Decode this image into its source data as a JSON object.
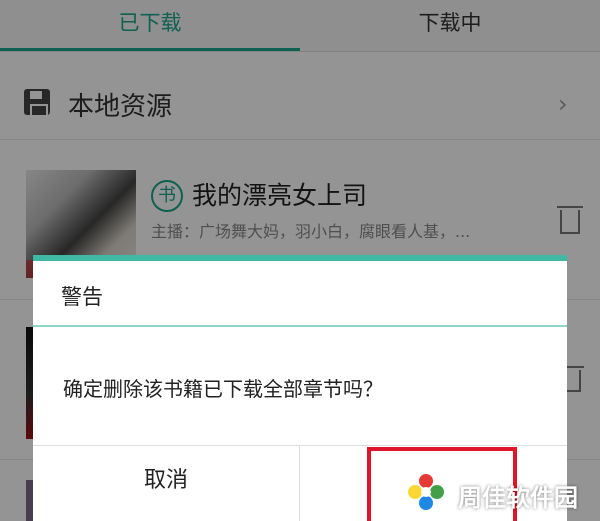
{
  "tabs": [
    {
      "label": "已下载",
      "active": true
    },
    {
      "label": "下载中",
      "active": false
    }
  ],
  "local_resources": {
    "label": "本地资源",
    "icon": "floppy-icon",
    "chevron": "›"
  },
  "books": [
    {
      "badge": "书",
      "title": "我的漂亮女上司",
      "anchors": "主播：广场舞大妈，羽小白，腐眼看人基，..."
    }
  ],
  "dialog": {
    "title": "警告",
    "message": "确定删除该书籍已下载全部章节吗？",
    "cancel_label": "取消",
    "confirm_label": ""
  },
  "watermark": {
    "text": "周佳软件园"
  },
  "colors": {
    "accent": "#19a58a",
    "dialog_top_bar": "#3fb8a4",
    "highlight": "#e0152a"
  }
}
